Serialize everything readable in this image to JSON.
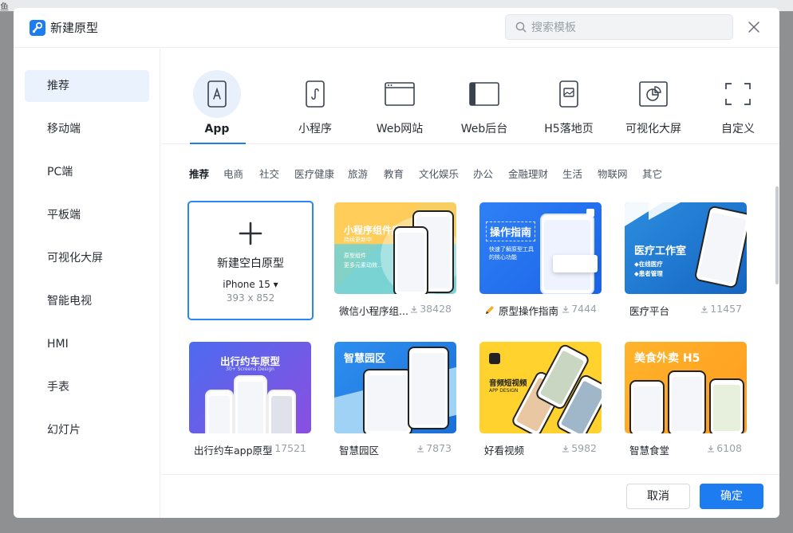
{
  "background_fragment": "鱼",
  "dialog": {
    "title": "新建原型",
    "search_placeholder": "搜索模板",
    "close_label": "×"
  },
  "sidebar": {
    "items": [
      "推荐",
      "移动端",
      "PC端",
      "平板端",
      "可视化大屏",
      "智能电视",
      "HMI",
      "手表",
      "幻灯片"
    ],
    "active_index": 0
  },
  "categories": {
    "items": [
      {
        "label": "App",
        "icon": "phone-app-icon"
      },
      {
        "label": "小程序",
        "icon": "mini-program-icon"
      },
      {
        "label": "Web网站",
        "icon": "web-browser-icon"
      },
      {
        "label": "Web后台",
        "icon": "web-admin-icon"
      },
      {
        "label": "H5落地页",
        "icon": "h5-page-icon"
      },
      {
        "label": "可视化大屏",
        "icon": "dashboard-chart-icon"
      },
      {
        "label": "自定义",
        "icon": "custom-frame-icon"
      }
    ],
    "active_index": 0
  },
  "tags": {
    "items": [
      "推荐",
      "电商",
      "社交",
      "医疗健康",
      "旅游",
      "教育",
      "文化娱乐",
      "办公",
      "金融理财",
      "生活",
      "物联网",
      "其它"
    ],
    "active_index": 0
  },
  "blank_card": {
    "title": "新建空白原型",
    "device": "iPhone 15 ▾",
    "size": "393 x 852"
  },
  "templates": [
    {
      "name": "微信小程序组...",
      "downloads": "38428",
      "thumb_title": "小程序组件库",
      "thumb_sub": "持续更新中",
      "thumb_lines": [
        "原型组件",
        "更多元素动效..."
      ]
    },
    {
      "name": "原型操作指南",
      "downloads": "7444",
      "thumb_title": "操作指南",
      "thumb_sub": "快速了解原型工具的核心功能"
    },
    {
      "name": "医疗平台",
      "downloads": "11457",
      "thumb_title": "医疗工作室",
      "thumb_lines": [
        "◆在线医疗",
        "◆患者管理"
      ]
    },
    {
      "name": "出行约车app原型",
      "downloads": "17521",
      "thumb_title": "出行约车原型",
      "thumb_sub": "30+ Screens Design"
    },
    {
      "name": "智慧园区",
      "downloads": "7873",
      "thumb_title": "智慧园区"
    },
    {
      "name": "好看视频",
      "downloads": "5982",
      "thumb_title": "音频短视频",
      "thumb_sub": "APP DESIGN"
    },
    {
      "name": "智慧食堂",
      "downloads": "6108",
      "thumb_title": "美食外卖 H5"
    }
  ],
  "footer": {
    "cancel_label": "取消",
    "ok_label": "确定"
  },
  "colors": {
    "accent": "#1e7cf1",
    "active_bg": "#eaf2fd"
  }
}
